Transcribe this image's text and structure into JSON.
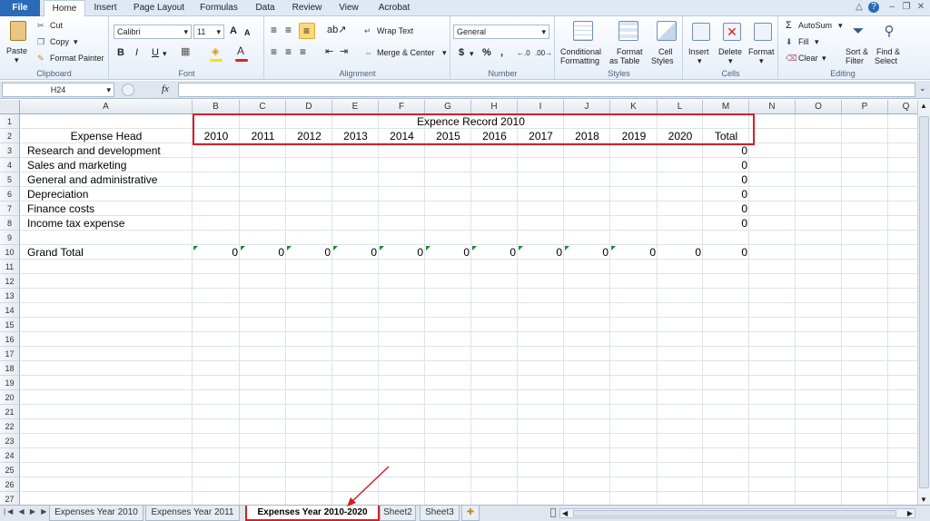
{
  "ribbon_tabs": [
    "File",
    "Home",
    "Insert",
    "Page Layout",
    "Formulas",
    "Data",
    "Review",
    "View",
    "Acrobat"
  ],
  "clipboard": {
    "paste": "Paste",
    "cut": "Cut",
    "copy": "Copy",
    "format_painter": "Format Painter",
    "label": "Clipboard"
  },
  "font": {
    "name": "Calibri",
    "size": "11",
    "bold": "B",
    "italic": "I",
    "underline": "U",
    "grow": "A",
    "shrink": "A",
    "label": "Font"
  },
  "alignment": {
    "wrap_text": "Wrap Text",
    "merge_center": "Merge & Center",
    "label": "Alignment"
  },
  "number": {
    "format": "General",
    "currency": "$",
    "percent": "%",
    "comma": ",",
    "label": "Number"
  },
  "styles": {
    "conditional": "Conditional",
    "conditional2": "Formatting",
    "format_table": "Format",
    "format_table2": "as Table",
    "cell_styles": "Cell",
    "cell_styles2": "Styles",
    "label": "Styles"
  },
  "cells": {
    "insert": "Insert",
    "delete": "Delete",
    "format": "Format",
    "label": "Cells"
  },
  "editing": {
    "autosum": "AutoSum",
    "fill": "Fill",
    "clear": "Clear",
    "sort": "Sort &",
    "sort2": "Filter",
    "find": "Find &",
    "find2": "Select",
    "label": "Editing"
  },
  "formula_bar": {
    "name_box": "H24",
    "fx": "fx",
    "value": ""
  },
  "columns": [
    "A",
    "B",
    "C",
    "D",
    "E",
    "F",
    "G",
    "H",
    "I",
    "J",
    "K",
    "L",
    "M",
    "N",
    "O",
    "P",
    "Q"
  ],
  "rows": [
    "1",
    "2",
    "3",
    "4",
    "5",
    "6",
    "7",
    "8",
    "9",
    "10",
    "11",
    "12",
    "13",
    "14",
    "15",
    "16",
    "17",
    "18",
    "19",
    "20",
    "21",
    "22",
    "23",
    "24",
    "25",
    "26",
    "27"
  ],
  "sheet": {
    "title": "Expence Record 2010",
    "expense_head": "Expense Head",
    "years": [
      "2010",
      "2011",
      "2012",
      "2013",
      "2014",
      "2015",
      "2016",
      "2017",
      "2018",
      "2019",
      "2020"
    ],
    "total_header": "Total",
    "expenses": [
      {
        "name": "Research and development",
        "total": "0"
      },
      {
        "name": "Sales and marketing",
        "total": "0"
      },
      {
        "name": "General and administrative",
        "total": "0"
      },
      {
        "name": "Depreciation",
        "total": "0"
      },
      {
        "name": "Finance costs",
        "total": "0"
      },
      {
        "name": "Income tax expense",
        "total": "0"
      }
    ],
    "grand_total_label": "Grand Total",
    "grand_totals": [
      "0",
      "0",
      "0",
      "0",
      "0",
      "0",
      "0",
      "0",
      "0",
      "0",
      "0"
    ],
    "grand_total_sum": "0"
  },
  "sheet_tabs": [
    "Expenses Year 2010",
    "Expenses Year 2011",
    "Expenses Year 2010-2020",
    "Sheet2",
    "Sheet3"
  ],
  "colors": {
    "highlight": "#d81e26",
    "file_tab": "#2a6ab8",
    "error_triangle": "#1a8a2a"
  }
}
